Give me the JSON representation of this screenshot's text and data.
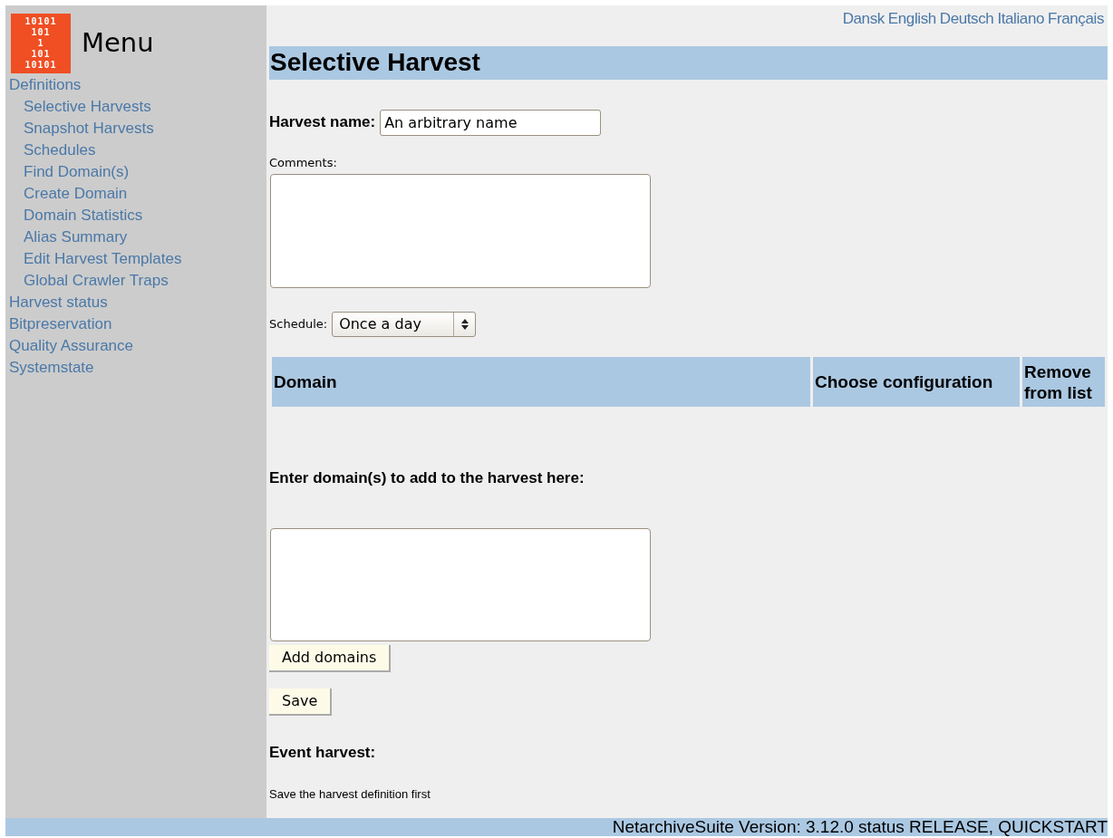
{
  "logo": {
    "lines": [
      "10101",
      "101",
      "1",
      "101",
      "10101"
    ]
  },
  "sidebar": {
    "title": "Menu",
    "items": [
      {
        "label": "Definitions",
        "children": [
          {
            "label": "Selective Harvests"
          },
          {
            "label": "Snapshot Harvests"
          },
          {
            "label": "Schedules"
          },
          {
            "label": "Find Domain(s)"
          },
          {
            "label": "Create Domain"
          },
          {
            "label": "Domain Statistics"
          },
          {
            "label": "Alias Summary"
          },
          {
            "label": "Edit Harvest Templates"
          },
          {
            "label": "Global Crawler Traps"
          }
        ]
      },
      {
        "label": "Harvest status"
      },
      {
        "label": "Bitpreservation"
      },
      {
        "label": "Quality Assurance"
      },
      {
        "label": "Systemstate"
      }
    ]
  },
  "languages": [
    "Dansk",
    "English",
    "Deutsch",
    "Italiano",
    "Français"
  ],
  "page_title": "Selective Harvest",
  "harvest_name": {
    "label": "Harvest name:",
    "value": "An arbitrary name"
  },
  "comments": {
    "label": "Comments:"
  },
  "schedule": {
    "label": "Schedule:",
    "value": "Once a day"
  },
  "table": {
    "columns": [
      "Domain",
      "Choose configuration",
      "Remove from list"
    ]
  },
  "add_domains": {
    "label": "Enter domain(s) to add to the harvest here:",
    "button": "Add domains"
  },
  "save_button": "Save",
  "event_harvest": {
    "heading": "Event harvest:",
    "note": "Save the harvest definition first"
  },
  "status_bar": "NetarchiveSuite Version: 3.12.0 status RELEASE, QUICKSTART"
}
